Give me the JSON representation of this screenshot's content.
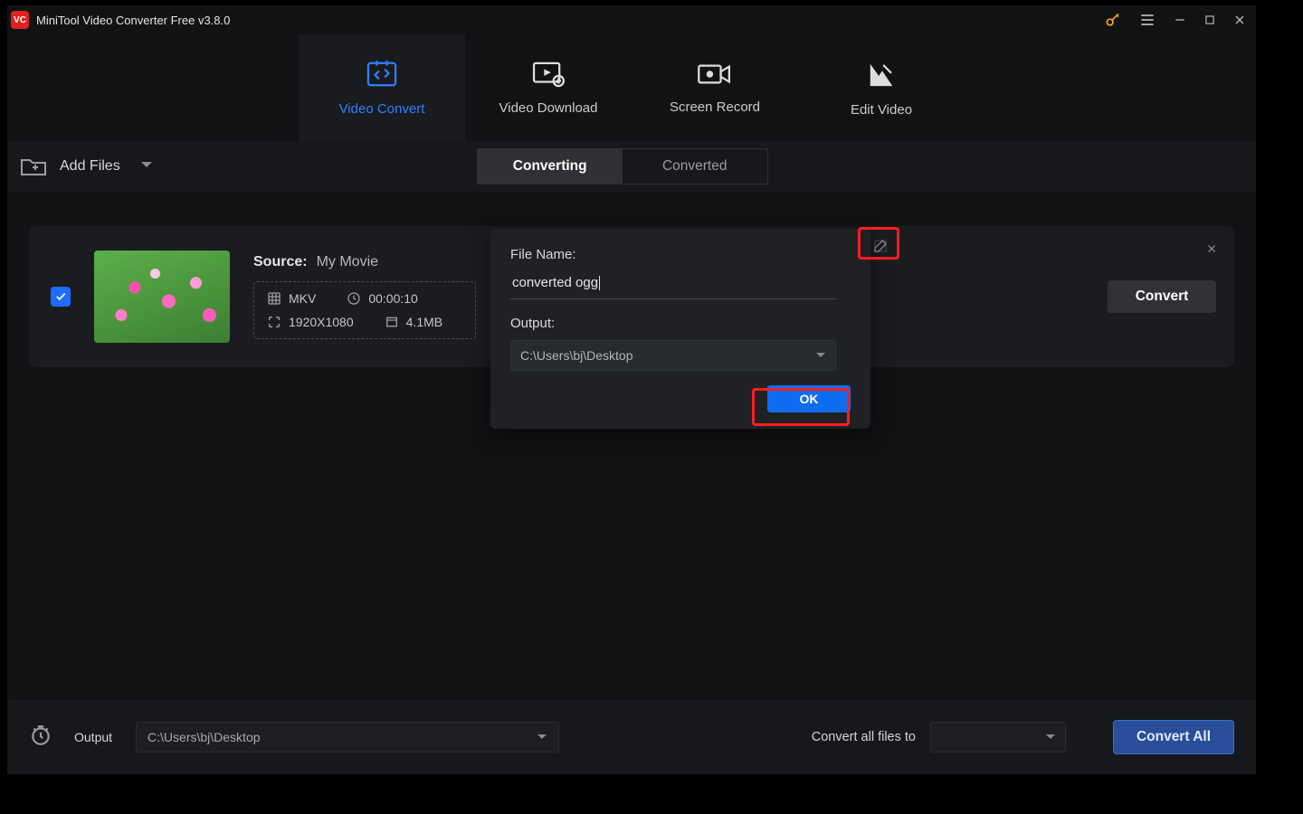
{
  "title": "MiniTool Video Converter Free v3.8.0",
  "nav": {
    "video_convert": "Video Convert",
    "video_download": "Video Download",
    "screen_record": "Screen Record",
    "edit_video": "Edit Video"
  },
  "toolbar": {
    "add_files": "Add Files",
    "seg_converting": "Converting",
    "seg_converted": "Converted"
  },
  "item": {
    "source_label": "Source:",
    "source_name": "My Movie",
    "format": "MKV",
    "duration": "00:00:10",
    "resolution": "1920X1080",
    "size": "4.1MB",
    "convert_btn": "Convert"
  },
  "modal": {
    "filename_label": "File Name:",
    "filename_value": "converted ogg",
    "output_label": "Output:",
    "output_path": "C:\\Users\\bj\\Desktop",
    "ok": "OK"
  },
  "footer": {
    "output_label": "Output",
    "output_path": "C:\\Users\\bj\\Desktop",
    "convert_all_label": "Convert all files to",
    "convert_all_btn": "Convert All"
  }
}
